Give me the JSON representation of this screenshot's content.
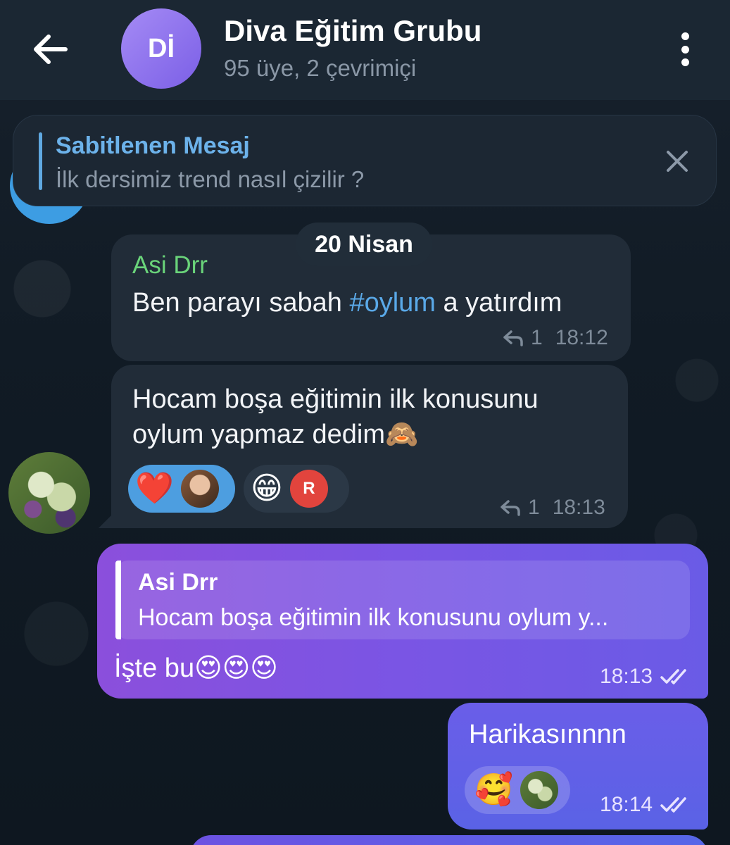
{
  "header": {
    "back_icon": "arrow-left-icon",
    "avatar_initials": "Dİ",
    "title": "Diva Eğitim Grubu",
    "subtitle": "95 üye, 2 çevrimiçi",
    "menu_icon": "more-vertical-icon"
  },
  "pinned": {
    "title": "Sabitlenen Mesaj",
    "text": "İlk dersimiz trend nasıl çizilir ?",
    "close_icon": "close-icon"
  },
  "date_separator": "20 Nisan",
  "messages": [
    {
      "sender": "Asi Drr",
      "text_before": "Ben parayı sabah ",
      "hashtag": "#oylum",
      "text_after": " a yatırdım",
      "reply_count": "1",
      "time": "18:12"
    },
    {
      "line1": "Hocam boşa eğitimin ilk konusunu",
      "line2": "oylum yapmaz dedim🙈",
      "reactions": [
        {
          "emoji": "❤️",
          "active": true
        },
        {
          "emoji": "😁",
          "avatar_letter": "R",
          "avatar_color": "#e2443d",
          "active": false
        }
      ],
      "reply_count": "1",
      "time": "18:13"
    },
    {
      "quote_name": "Asi Drr",
      "quote_text": "Hocam boşa eğitimin ilk konusunu oylum y...",
      "text": "İşte bu😍😍😍",
      "time": "18:13"
    },
    {
      "text": "Harikasınnnn",
      "reaction_emoji": "🥰",
      "time": "18:14"
    }
  ],
  "colors": {
    "accent_blue": "#4d9ee0",
    "sender_green": "#6ad47a",
    "outgoing_purple": "#7a55e4"
  }
}
